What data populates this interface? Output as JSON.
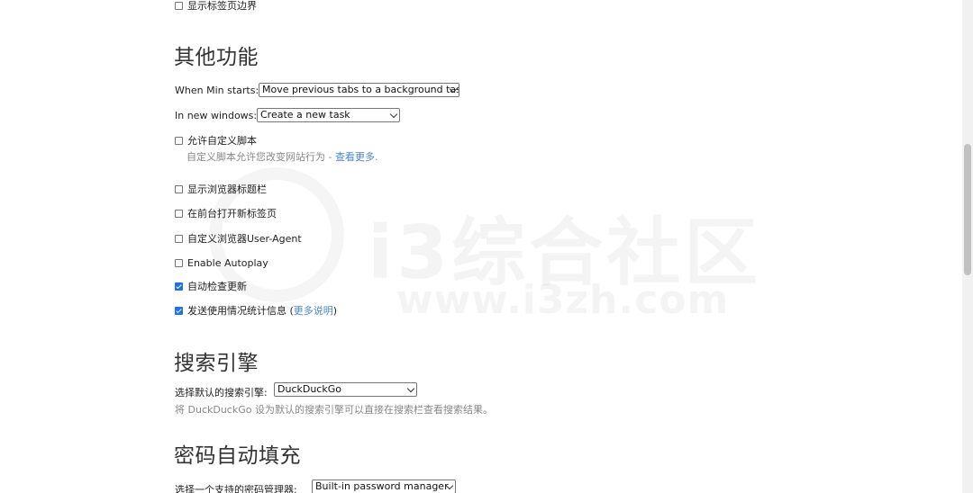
{
  "top_checkbox": {
    "label": "显示标签页边界",
    "checked": false
  },
  "other_features": {
    "heading": "其他功能",
    "startup": {
      "label": "When Min starts:",
      "selected": "Move previous tabs to a background task"
    },
    "new_window": {
      "label": "In new windows:",
      "selected": "Create a new task"
    },
    "custom_script": {
      "label": "允许自定义脚本",
      "checked": false,
      "desc": "自定义脚本允许您改变网站行为 - ",
      "link": "查看更多",
      "desc_end": "."
    },
    "items": [
      {
        "label": "显示浏览器标题栏",
        "checked": false
      },
      {
        "label": "在前台打开新标签页",
        "checked": false
      },
      {
        "label": "自定义浏览器User-Agent",
        "checked": false
      },
      {
        "label": "Enable Autoplay",
        "checked": false
      },
      {
        "label": "自动检查更新",
        "checked": true
      }
    ],
    "usage_stats": {
      "label": "发送使用情况统计信息 (",
      "link": "更多说明",
      "label_end": ")",
      "checked": true
    }
  },
  "search_engine": {
    "heading": "搜索引擎",
    "label": "选择默认的搜索引擎:",
    "selected": "DuckDuckGo",
    "desc": "将 DuckDuckGo 设为默认的搜索引擎可以直接在搜索栏查看搜索结果。"
  },
  "password": {
    "heading": "密码自动填充",
    "label": "选择一个支持的密码管理器:",
    "selected": "Built-in password manager"
  },
  "watermark": {
    "line1": "i3综合社区",
    "line2": "www.i3zh.com"
  }
}
